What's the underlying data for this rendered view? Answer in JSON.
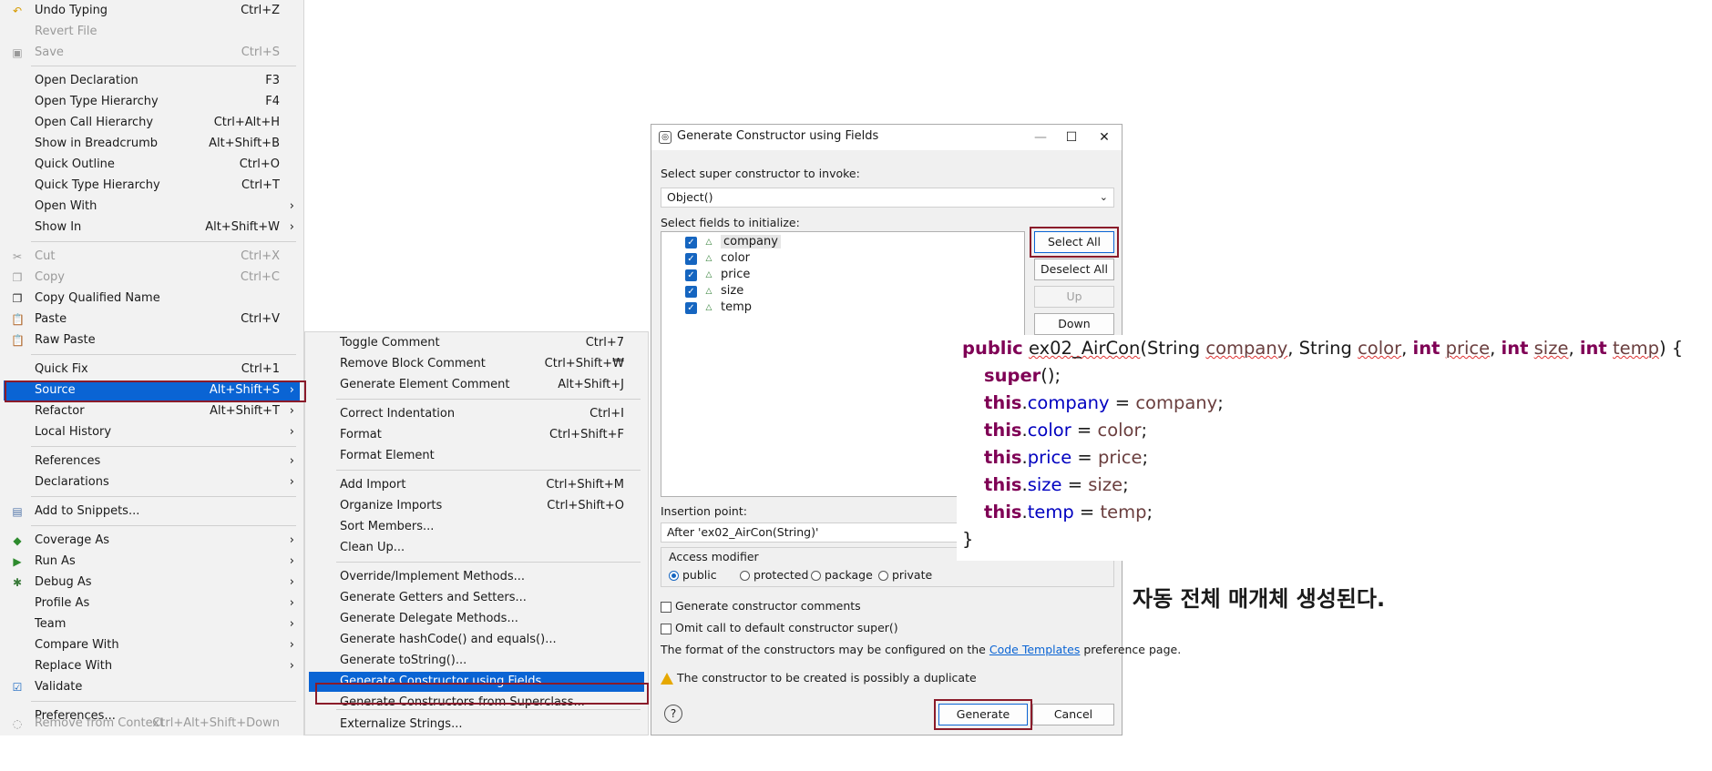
{
  "menu1": {
    "items": [
      {
        "label": "Undo Typing",
        "shortcut": "Ctrl+Z",
        "icon": "undo-icon",
        "disabled": false
      },
      {
        "label": "Revert File",
        "shortcut": "",
        "icon": "",
        "disabled": true
      },
      {
        "label": "Save",
        "shortcut": "Ctrl+S",
        "icon": "save-icon",
        "disabled": true
      },
      {
        "label": "Open Declaration",
        "shortcut": "F3",
        "icon": "",
        "disabled": false
      },
      {
        "label": "Open Type Hierarchy",
        "shortcut": "F4",
        "icon": "",
        "disabled": false
      },
      {
        "label": "Open Call Hierarchy",
        "shortcut": "Ctrl+Alt+H",
        "icon": "",
        "disabled": false
      },
      {
        "label": "Show in Breadcrumb",
        "shortcut": "Alt+Shift+B",
        "icon": "",
        "disabled": false
      },
      {
        "label": "Quick Outline",
        "shortcut": "Ctrl+O",
        "icon": "",
        "disabled": false
      },
      {
        "label": "Quick Type Hierarchy",
        "shortcut": "Ctrl+T",
        "icon": "",
        "disabled": false
      },
      {
        "label": "Open With",
        "shortcut": "",
        "submenu": true,
        "icon": "",
        "disabled": false
      },
      {
        "label": "Show In",
        "shortcut": "Alt+Shift+W",
        "submenu": true,
        "icon": "",
        "disabled": false
      },
      {
        "label": "Cut",
        "shortcut": "Ctrl+X",
        "icon": "cut-icon",
        "disabled": true
      },
      {
        "label": "Copy",
        "shortcut": "Ctrl+C",
        "icon": "copy-icon",
        "disabled": true
      },
      {
        "label": "Copy Qualified Name",
        "shortcut": "",
        "icon": "copy-qualified-icon",
        "disabled": false
      },
      {
        "label": "Paste",
        "shortcut": "Ctrl+V",
        "icon": "paste-icon",
        "disabled": false
      },
      {
        "label": "Raw Paste",
        "shortcut": "",
        "icon": "raw-paste-icon",
        "disabled": false
      },
      {
        "label": "Quick Fix",
        "shortcut": "Ctrl+1",
        "icon": "",
        "disabled": false
      },
      {
        "label": "Source",
        "shortcut": "Alt+Shift+S",
        "submenu": true,
        "icon": "",
        "disabled": false,
        "selected": true
      },
      {
        "label": "Refactor",
        "shortcut": "Alt+Shift+T",
        "submenu": true,
        "icon": "",
        "disabled": false
      },
      {
        "label": "Local History",
        "shortcut": "",
        "submenu": true,
        "icon": "",
        "disabled": false
      },
      {
        "label": "References",
        "shortcut": "",
        "submenu": true,
        "icon": "",
        "disabled": false
      },
      {
        "label": "Declarations",
        "shortcut": "",
        "submenu": true,
        "icon": "",
        "disabled": false
      },
      {
        "label": "Add to Snippets...",
        "shortcut": "",
        "icon": "snippets-icon",
        "disabled": false
      },
      {
        "label": "Coverage As",
        "shortcut": "",
        "submenu": true,
        "icon": "coverage-icon",
        "disabled": false
      },
      {
        "label": "Run As",
        "shortcut": "",
        "submenu": true,
        "icon": "run-icon",
        "disabled": false
      },
      {
        "label": "Debug As",
        "shortcut": "",
        "submenu": true,
        "icon": "debug-icon",
        "disabled": false
      },
      {
        "label": "Profile As",
        "shortcut": "",
        "submenu": true,
        "icon": "",
        "disabled": false
      },
      {
        "label": "Team",
        "shortcut": "",
        "submenu": true,
        "icon": "",
        "disabled": false
      },
      {
        "label": "Compare With",
        "shortcut": "",
        "submenu": true,
        "icon": "",
        "disabled": false
      },
      {
        "label": "Replace With",
        "shortcut": "",
        "submenu": true,
        "icon": "",
        "disabled": false
      },
      {
        "label": "Validate",
        "shortcut": "",
        "icon": "validate-check-icon",
        "disabled": false
      },
      {
        "label": "Preferences...",
        "shortcut": "",
        "icon": "",
        "disabled": false
      },
      {
        "label": "Remove from Context",
        "shortcut": "Ctrl+Alt+Shift+Down",
        "icon": "remove-context-icon",
        "disabled": true
      }
    ]
  },
  "menu2": {
    "items": [
      {
        "label": "Toggle Comment",
        "shortcut": "Ctrl+7"
      },
      {
        "label": "Remove Block Comment",
        "shortcut": "Ctrl+Shift+₩"
      },
      {
        "label": "Generate Element Comment",
        "shortcut": "Alt+Shift+J"
      },
      {
        "label": "Correct Indentation",
        "shortcut": "Ctrl+I"
      },
      {
        "label": "Format",
        "shortcut": "Ctrl+Shift+F"
      },
      {
        "label": "Format Element",
        "shortcut": ""
      },
      {
        "label": "Add Import",
        "shortcut": "Ctrl+Shift+M"
      },
      {
        "label": "Organize Imports",
        "shortcut": "Ctrl+Shift+O"
      },
      {
        "label": "Sort Members...",
        "shortcut": ""
      },
      {
        "label": "Clean Up...",
        "shortcut": ""
      },
      {
        "label": "Override/Implement Methods...",
        "shortcut": ""
      },
      {
        "label": "Generate Getters and Setters...",
        "shortcut": ""
      },
      {
        "label": "Generate Delegate Methods...",
        "shortcut": ""
      },
      {
        "label": "Generate hashCode() and equals()...",
        "shortcut": ""
      },
      {
        "label": "Generate toString()...",
        "shortcut": ""
      },
      {
        "label": "Generate Constructor using Fields...",
        "shortcut": "",
        "selected": true
      },
      {
        "label": "Generate Constructors from Superclass...",
        "shortcut": ""
      },
      {
        "label": "Externalize Strings...",
        "shortcut": ""
      }
    ]
  },
  "dialog": {
    "title": "Generate Constructor using Fields",
    "super_label": "Select super constructor to invoke:",
    "super_value": "Object()",
    "fields_label": "Select fields to initialize:",
    "fields": [
      "company",
      "color",
      "price",
      "size",
      "temp"
    ],
    "buttons": {
      "select_all": "Select All",
      "deselect_all": "Deselect All",
      "up": "Up",
      "down": "Down"
    },
    "insertion_label": "Insertion point:",
    "insertion_value": "After 'ex02_AirCon(String)'",
    "access_label": "Access modifier",
    "access_options": [
      "public",
      "protected",
      "package",
      "private"
    ],
    "access_selected": "public",
    "gen_comments": "Generate constructor comments",
    "omit_super": "Omit call to default constructor super()",
    "format_prefix": "The format of the constructors may be configured on the",
    "format_link": "Code Templates",
    "format_suffix": "preference page.",
    "warning": "The constructor to be created is possibly a duplicate",
    "generate": "Generate",
    "cancel": "Cancel"
  },
  "code": {
    "kw_public": "public",
    "name": "ex02_AirCon",
    "sig_open": "(",
    "type_string": "String",
    "kw_int": "int",
    "p_company": "company",
    "p_color": "color",
    "p_price": "price",
    "p_size": "size",
    "p_temp": "temp",
    "sig_close": ") {",
    "kw_super": "super",
    "super_call": "();",
    "kw_this": "this",
    "close_brace": "}"
  },
  "caption": "자동 전체 매개체 생성된다."
}
